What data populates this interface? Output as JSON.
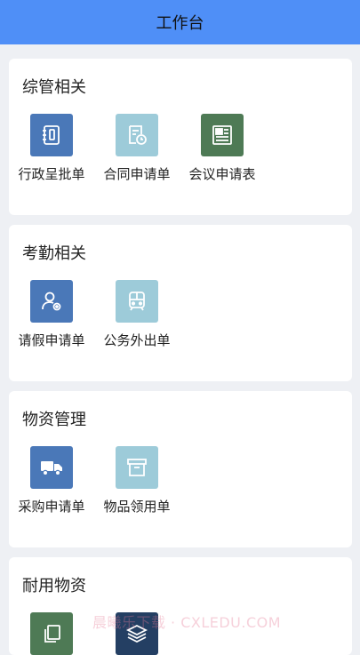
{
  "header": {
    "title": "工作台"
  },
  "sections": [
    {
      "title": "综管相关",
      "items": [
        {
          "label": "行政呈批单",
          "icon": "notebook-icon",
          "color": "#4a78b8"
        },
        {
          "label": "合同申请单",
          "icon": "document-clock-icon",
          "color": "#9dcbd9"
        },
        {
          "label": "会议申请表",
          "icon": "newspaper-icon",
          "color": "#4e7a55"
        }
      ]
    },
    {
      "title": "考勤相关",
      "items": [
        {
          "label": "请假申请单",
          "icon": "user-settings-icon",
          "color": "#4a78b8"
        },
        {
          "label": "公务外出单",
          "icon": "train-icon",
          "color": "#9dcbd9"
        }
      ]
    },
    {
      "title": "物资管理",
      "items": [
        {
          "label": "采购申请单",
          "icon": "truck-icon",
          "color": "#4a78b8"
        },
        {
          "label": "物品领用单",
          "icon": "archive-box-icon",
          "color": "#9dcbd9"
        }
      ]
    },
    {
      "title": "耐用物资",
      "items": [
        {
          "label": "",
          "icon": "copy-icon",
          "color": "#4e7a55"
        },
        {
          "label": "",
          "icon": "layers-icon",
          "color": "#243f63"
        }
      ]
    }
  ],
  "watermark": "晨曦乐下载 · CXLEDU.COM"
}
